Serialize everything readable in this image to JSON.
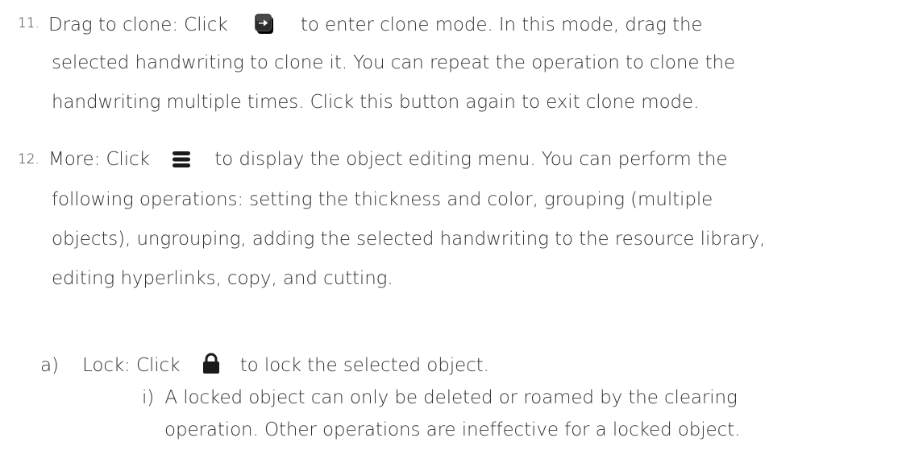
{
  "item11": {
    "number": "11.",
    "label": "Drag to clone:",
    "click_word": "Click",
    "after_icon": "to enter clone mode. In this mode, drag the",
    "line2": "selected handwriting to clone it. You can repeat the operation to clone the",
    "line3": "handwriting multiple times. Click this button again to exit clone mode.",
    "icon": "clone-icon"
  },
  "item12": {
    "number": "12.",
    "label": "More:",
    "click_word": "Click",
    "after_icon": "to display the object editing menu. You can perform the",
    "line2": "following operations: setting the thickness and color, grouping (multiple",
    "line3": "objects), ungrouping, adding the selected handwriting to the resource library,",
    "line4": "editing hyperlinks, copy, and cutting.",
    "icon": "menu-icon"
  },
  "sub_a": {
    "marker": "a)",
    "label": "Lock:",
    "click_word": "Click",
    "after_icon": "to lock the selected object.",
    "icon": "lock-icon"
  },
  "sub_i": {
    "marker": "i)",
    "line1": "A locked object can only be deleted or roamed by the clearing",
    "line2": "operation. Other operations are ineffective for a locked object."
  },
  "colors": {
    "text": "#333333",
    "icon_dark": "#1a1a1a"
  }
}
